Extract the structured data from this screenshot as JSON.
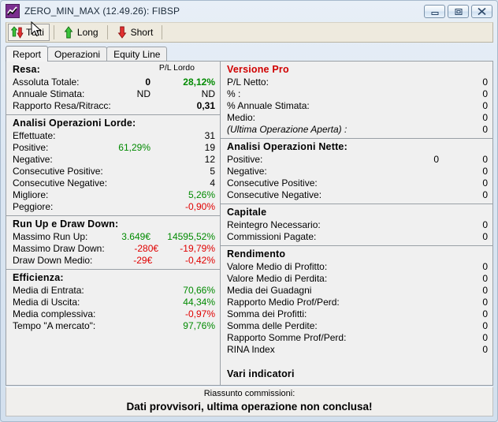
{
  "window": {
    "title": "ZERO_MIN_MAX (12.49.26): FIBSP",
    "icon": "chart-line-icon",
    "minimize_label": "Minimize",
    "maximize_label": "Maximize",
    "close_label": "Close"
  },
  "toolbar": {
    "buttons": [
      {
        "label": "Tutti",
        "icon": "up-down-arrow-icon",
        "pressed": true
      },
      {
        "label": "Long",
        "icon": "up-arrow-icon",
        "pressed": false
      },
      {
        "label": "Short",
        "icon": "down-arrow-icon",
        "pressed": false
      }
    ]
  },
  "tabs": [
    {
      "label": "Report",
      "active": true
    },
    {
      "label": "Operazioni",
      "active": false
    },
    {
      "label": "Equity Line",
      "active": false
    }
  ],
  "left": {
    "resa": {
      "header": "Resa:",
      "col_header": "P/L Lordo",
      "rows": [
        {
          "label": "Assoluta Totale:",
          "v1": "0",
          "v1_class": "bold",
          "v2": "28,12%",
          "v2_class": "green bold"
        },
        {
          "label": "Annuale Stimata:",
          "v1": "ND",
          "v1_class": "",
          "v2": "ND",
          "v2_class": ""
        },
        {
          "label": "Rapporto Resa/Ritracc:",
          "v1": "",
          "v1_class": "",
          "v2": "0,31",
          "v2_class": "bold"
        }
      ]
    },
    "analisi_lorde": {
      "header": "Analisi Operazioni Lorde:",
      "rows": [
        {
          "label": "Effettuate:",
          "v1": "",
          "v1_class": "",
          "v2": "31",
          "v2_class": ""
        },
        {
          "label": "Positive:",
          "v1": "61,29%",
          "v1_class": "green",
          "v2": "19",
          "v2_class": ""
        },
        {
          "label": "Negative:",
          "v1": "",
          "v1_class": "",
          "v2": "12",
          "v2_class": ""
        },
        {
          "label": "Consecutive Positive:",
          "v1": "",
          "v1_class": "",
          "v2": "5",
          "v2_class": ""
        },
        {
          "label": "Consecutive Negative:",
          "v1": "",
          "v1_class": "",
          "v2": "4",
          "v2_class": ""
        },
        {
          "label": "Migliore:",
          "v1": "",
          "v1_class": "",
          "v2": "5,26%",
          "v2_class": "green"
        },
        {
          "label": "Peggiore:",
          "v1": "",
          "v1_class": "",
          "v2": "-0,90%",
          "v2_class": "red"
        }
      ]
    },
    "runup_drawdown": {
      "header": "Run Up e Draw Down:",
      "rows": [
        {
          "label": "Massimo Run Up:",
          "v1": "3.649€",
          "v1_class": "green",
          "v2": "14595,52%",
          "v2_class": "green"
        },
        {
          "label": "Massimo Draw Down:",
          "v1": "-280€",
          "v1_class": "red",
          "v2": "-19,79%",
          "v2_class": "red"
        },
        {
          "label": "Draw Down Medio:",
          "v1": "-29€",
          "v1_class": "red",
          "v2": "-0,42%",
          "v2_class": "red"
        }
      ]
    },
    "efficienza": {
      "header": "Efficienza:",
      "rows": [
        {
          "label": "Media di Entrata:",
          "v1": "",
          "v1_class": "",
          "v2": "70,66%",
          "v2_class": "green"
        },
        {
          "label": "Media di Uscita:",
          "v1": "",
          "v1_class": "",
          "v2": "44,34%",
          "v2_class": "green"
        },
        {
          "label": "Media complessiva:",
          "v1": "",
          "v1_class": "",
          "v2": "-0,97%",
          "v2_class": "red"
        },
        {
          "label": "Tempo \"A mercato\":",
          "v1": "",
          "v1_class": "",
          "v2": "97,76%",
          "v2_class": "green"
        }
      ]
    }
  },
  "right": {
    "versione_pro": {
      "header": "Versione Pro",
      "rows": [
        {
          "label": "P/L Netto:",
          "v1": "",
          "v1_class": "",
          "v2": "0",
          "v2_class": "",
          "italic": false
        },
        {
          "label": "% :",
          "v1": "",
          "v1_class": "",
          "v2": "0",
          "v2_class": "",
          "italic": false
        },
        {
          "label": "% Annuale Stimata:",
          "v1": "",
          "v1_class": "",
          "v2": "0",
          "v2_class": "",
          "italic": false
        },
        {
          "label": "Medio:",
          "v1": "",
          "v1_class": "",
          "v2": "0",
          "v2_class": "",
          "italic": false
        },
        {
          "label": "(Ultima Operazione Aperta) :",
          "v1": "",
          "v1_class": "",
          "v2": "0",
          "v2_class": "",
          "italic": true
        }
      ]
    },
    "analisi_nette": {
      "header": "Analisi Operazioni Nette:",
      "rows": [
        {
          "label": "Positive:",
          "v1": "0",
          "v1_class": "",
          "v2": "0",
          "v2_class": "",
          "italic": false
        },
        {
          "label": "Negative:",
          "v1": "",
          "v1_class": "",
          "v2": "0",
          "v2_class": "",
          "italic": false
        },
        {
          "label": "Consecutive Positive:",
          "v1": "",
          "v1_class": "",
          "v2": "0",
          "v2_class": "",
          "italic": false
        },
        {
          "label": "Consecutive Negative:",
          "v1": "",
          "v1_class": "",
          "v2": "0",
          "v2_class": "",
          "italic": false
        }
      ]
    },
    "capitale": {
      "header": "Capitale",
      "rows": [
        {
          "label": "Reintegro Necessario:",
          "v1": "",
          "v1_class": "",
          "v2": "0",
          "v2_class": "",
          "italic": false
        },
        {
          "label": "Commissioni Pagate:",
          "v1": "",
          "v1_class": "",
          "v2": "0",
          "v2_class": "",
          "italic": false
        }
      ]
    },
    "rendimento": {
      "header": "Rendimento",
      "rows": [
        {
          "label": "Valore Medio di Profitto:",
          "v1": "",
          "v1_class": "",
          "v2": "0",
          "v2_class": "",
          "italic": false
        },
        {
          "label": "Valore Medio di Perdita:",
          "v1": "",
          "v1_class": "",
          "v2": "0",
          "v2_class": "",
          "italic": false
        },
        {
          "label": "Media dei Guadagni",
          "v1": "",
          "v1_class": "",
          "v2": "0",
          "v2_class": "",
          "italic": false
        },
        {
          "label": "Rapporto Medio Prof/Perd:",
          "v1": "",
          "v1_class": "",
          "v2": "0",
          "v2_class": "",
          "italic": false
        },
        {
          "label": "Somma dei Profitti:",
          "v1": "",
          "v1_class": "",
          "v2": "0",
          "v2_class": "",
          "italic": false
        },
        {
          "label": "Somma delle Perdite:",
          "v1": "",
          "v1_class": "",
          "v2": "0",
          "v2_class": "",
          "italic": false
        },
        {
          "label": "Rapporto Somme Prof/Perd:",
          "v1": "",
          "v1_class": "",
          "v2": "0",
          "v2_class": "",
          "italic": false
        },
        {
          "label": "RINA Index",
          "v1": "",
          "v1_class": "",
          "v2": "0",
          "v2_class": "",
          "italic": false
        }
      ]
    },
    "vari_indicatori": {
      "header": "Vari indicatori"
    }
  },
  "status": {
    "line1": "Riassunto commissioni:",
    "line2": "Dati provvisori, ultima operazione non conclusa!"
  },
  "colors": {
    "positive": "#008a00",
    "negative": "#e00000",
    "pro_header": "#d00000",
    "panel_bg": "#f0f0f0",
    "toolbar_bg": "#eeeade"
  }
}
